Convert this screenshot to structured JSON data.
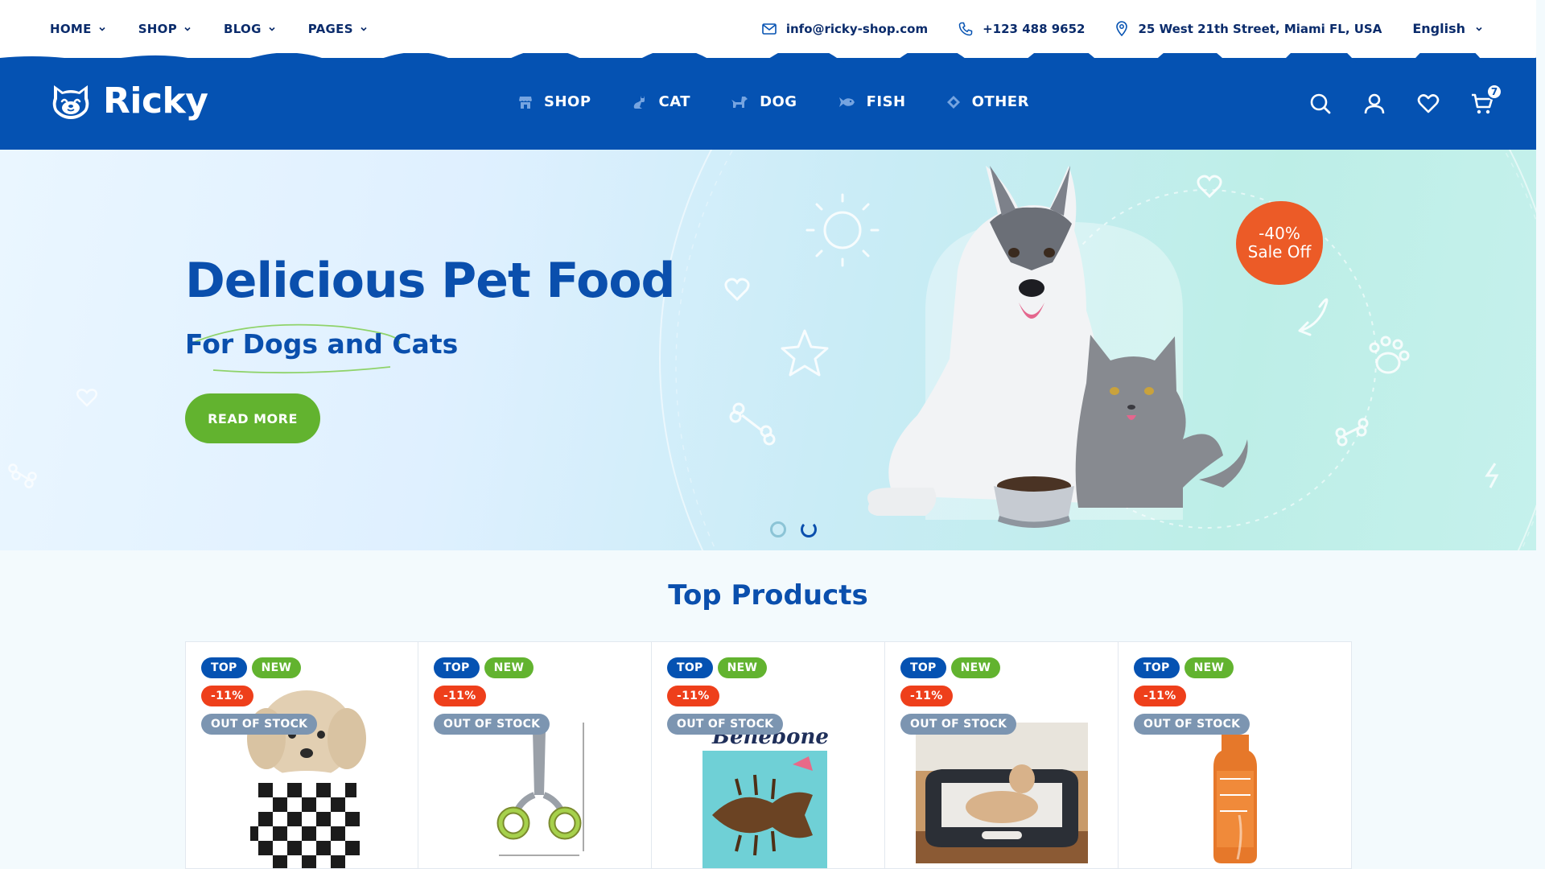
{
  "topnav": {
    "items": [
      {
        "label": "HOME"
      },
      {
        "label": "SHOP"
      },
      {
        "label": "BLOG"
      },
      {
        "label": "PAGES"
      }
    ]
  },
  "contact": {
    "email": "info@ricky-shop.com",
    "phone": "+123 488 9652",
    "address": "25 West 21th Street, Miami FL, USA"
  },
  "language": {
    "selected": "English"
  },
  "brand": {
    "name": "Ricky",
    "color": "#0552b2"
  },
  "catnav": {
    "items": [
      {
        "label": "SHOP",
        "icon": "store-icon"
      },
      {
        "label": "CAT",
        "icon": "cat-icon"
      },
      {
        "label": "DOG",
        "icon": "dog-icon"
      },
      {
        "label": "FISH",
        "icon": "fish-icon"
      },
      {
        "label": "OTHER",
        "icon": "diamond-icon"
      }
    ]
  },
  "header_actions": {
    "icons": [
      "search-icon",
      "user-icon",
      "heart-icon",
      "cart-icon"
    ],
    "cart_count": "7"
  },
  "hero": {
    "title": "Delicious Pet Food",
    "subtitle": "For Dogs and Cats",
    "button": "READ MORE",
    "sale_percent": "-40%",
    "sale_text": "Sale Off",
    "slides": 2,
    "active_slide": 2
  },
  "section": {
    "title": "Top Products"
  },
  "products": [
    {
      "badges": {
        "top": "TOP",
        "new": "NEW",
        "discount": "-11%",
        "stock": "OUT OF STOCK"
      },
      "image": "dog-shirt"
    },
    {
      "badges": {
        "top": "TOP",
        "new": "NEW",
        "discount": "-11%",
        "stock": "OUT OF STOCK"
      },
      "image": "nail-clipper"
    },
    {
      "badges": {
        "top": "TOP",
        "new": "NEW",
        "discount": "-11%",
        "stock": "OUT OF STOCK"
      },
      "image": "benebone-fish-chew",
      "image_text": "Benebone"
    },
    {
      "badges": {
        "top": "TOP",
        "new": "NEW",
        "discount": "-11%",
        "stock": "OUT OF STOCK"
      },
      "image": "pet-bed"
    },
    {
      "badges": {
        "top": "TOP",
        "new": "NEW",
        "discount": "-11%",
        "stock": "OUT OF STOCK"
      },
      "image": "dog-shampoo"
    }
  ]
}
